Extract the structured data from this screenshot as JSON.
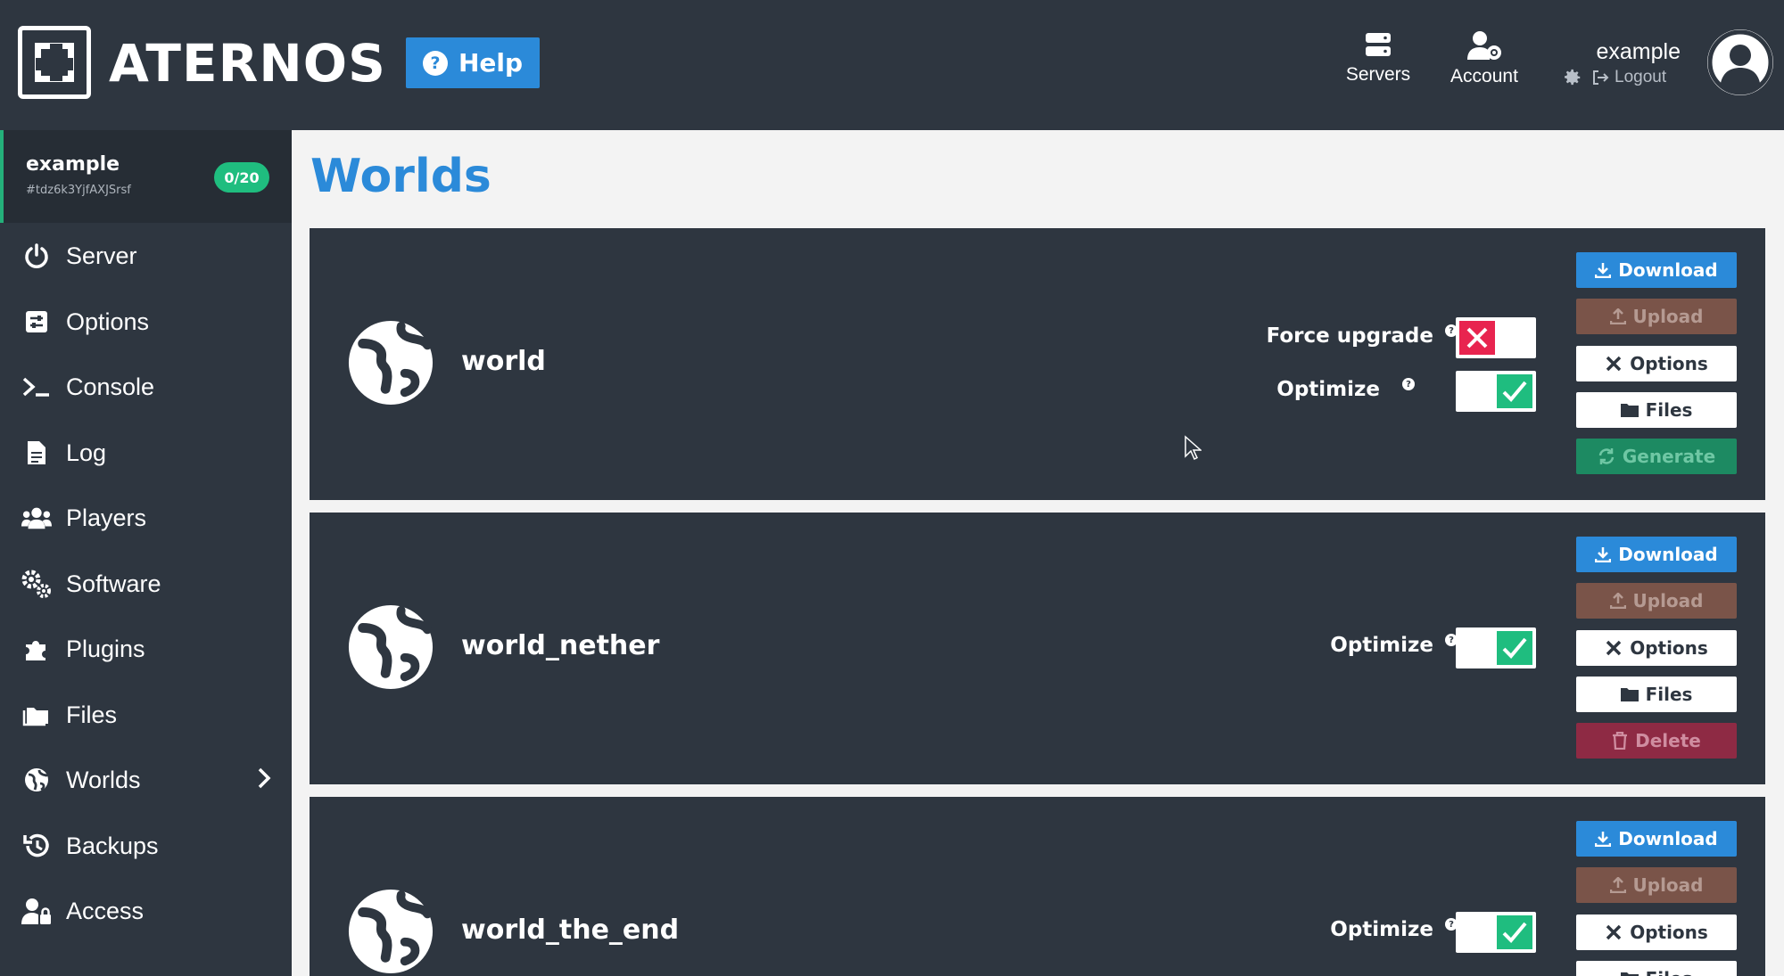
{
  "header": {
    "brand": "ATERNOS",
    "help_label": "Help",
    "nav": [
      {
        "label": "Servers",
        "icon": "servers-icon"
      },
      {
        "label": "Account",
        "icon": "account-icon"
      }
    ],
    "user": {
      "name": "example",
      "logout_label": "Logout"
    }
  },
  "sidebar": {
    "server": {
      "name": "example",
      "id": "#tdz6k3YjfAXJSrsf",
      "players": "0/20"
    },
    "items": [
      {
        "label": "Server",
        "icon": "power-icon"
      },
      {
        "label": "Options",
        "icon": "sliders-icon"
      },
      {
        "label": "Console",
        "icon": "terminal-icon"
      },
      {
        "label": "Log",
        "icon": "file-icon"
      },
      {
        "label": "Players",
        "icon": "users-icon"
      },
      {
        "label": "Software",
        "icon": "cogs-icon"
      },
      {
        "label": "Plugins",
        "icon": "puzzle-icon"
      },
      {
        "label": "Files",
        "icon": "folder-icon"
      },
      {
        "label": "Worlds",
        "icon": "globe-icon"
      },
      {
        "label": "Backups",
        "icon": "history-icon"
      },
      {
        "label": "Access",
        "icon": "user-lock-icon"
      }
    ]
  },
  "main": {
    "title": "Worlds",
    "worlds": [
      {
        "name": "world",
        "force_upgrade_label": "Force upgrade",
        "force_upgrade": false,
        "optimize_label": "Optimize",
        "optimize": true,
        "buttons": [
          "Download",
          "Upload",
          "Options",
          "Files",
          "Generate"
        ]
      },
      {
        "name": "world_nether",
        "optimize_label": "Optimize",
        "optimize": true,
        "buttons": [
          "Download",
          "Upload",
          "Options",
          "Files",
          "Delete"
        ]
      },
      {
        "name": "world_the_end",
        "optimize_label": "Optimize",
        "optimize": true,
        "buttons": [
          "Download",
          "Upload",
          "Options",
          "Files"
        ]
      }
    ]
  },
  "colors": {
    "accent": "#2b8ad9",
    "success": "#1fbd7f",
    "danger": "#e8244f",
    "panel": "#2e3640"
  }
}
